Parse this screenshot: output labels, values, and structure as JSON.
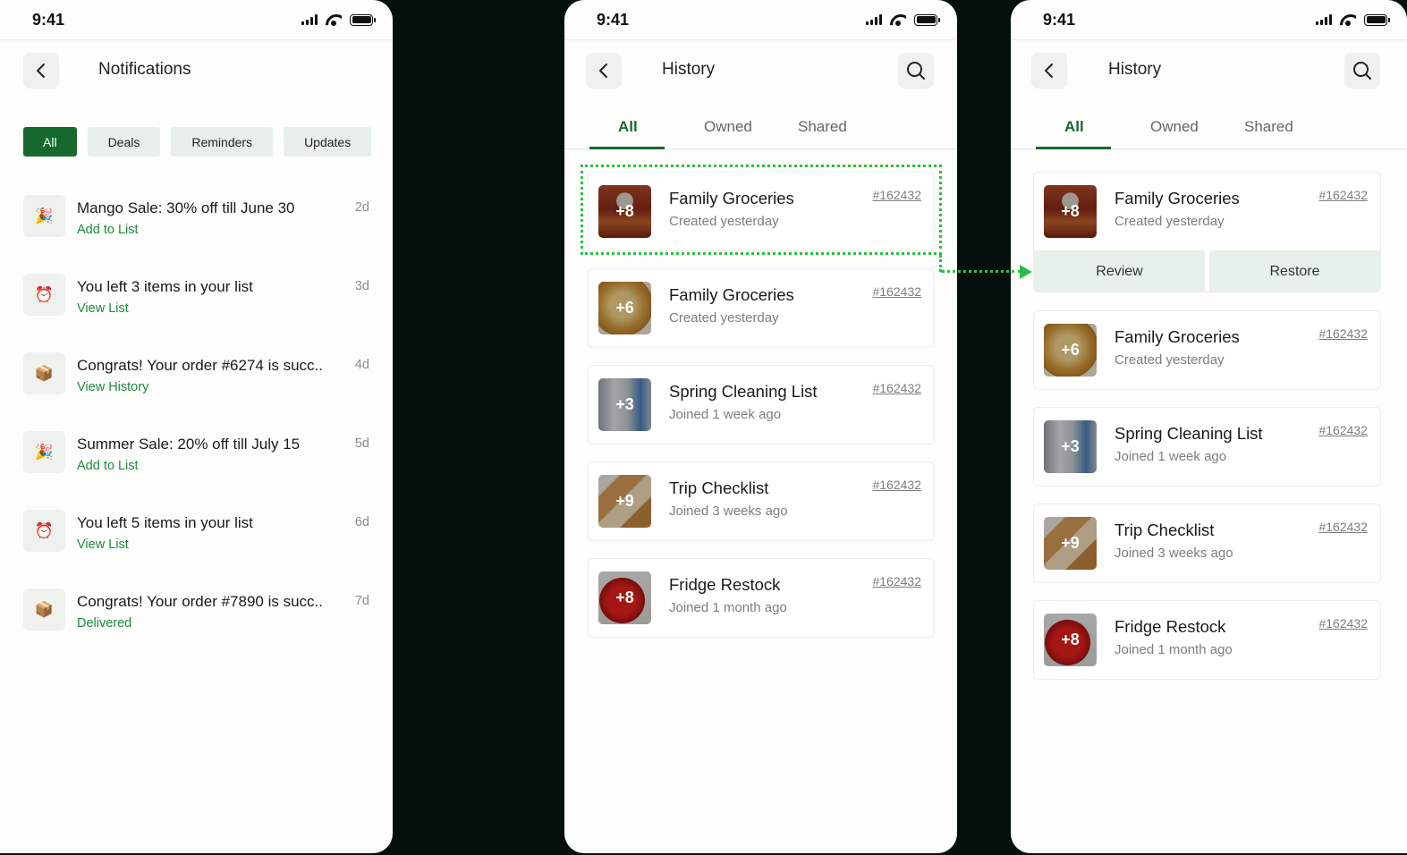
{
  "status_time": "9:41",
  "notifications_screen": {
    "title": "Notifications",
    "filters": [
      "All",
      "Deals",
      "Reminders",
      "Updates"
    ],
    "items": [
      {
        "icon": "party-popper-icon",
        "glyph": "🎉",
        "title": "Mango Sale: 30% off till June 30",
        "action": "Add to List",
        "age": "2d"
      },
      {
        "icon": "alarm-clock-icon",
        "glyph": "⏰",
        "title": "You left 3 items in your list",
        "action": "View List",
        "age": "3d"
      },
      {
        "icon": "package-icon",
        "glyph": "📦",
        "title": "Congrats! Your order #6274 is succ..",
        "action": "View History",
        "age": "4d"
      },
      {
        "icon": "party-popper-icon",
        "glyph": "🎉",
        "title": "Summer Sale: 20% off till July 15",
        "action": "Add to List",
        "age": "5d"
      },
      {
        "icon": "alarm-clock-icon",
        "glyph": "⏰",
        "title": "You left 5 items in your list",
        "action": "View List",
        "age": "6d"
      },
      {
        "icon": "package-icon",
        "glyph": "📦",
        "title": "Congrats! Your order #7890 is succ..",
        "action": "Delivered",
        "age": "7d"
      }
    ]
  },
  "history_screen": {
    "title": "History",
    "tabs": [
      "All",
      "Owned",
      "Shared"
    ],
    "lists": [
      {
        "title": "Family Groceries",
        "subtitle": "Created yesterday",
        "id": "#162432",
        "extra": "+8",
        "image": "jar"
      },
      {
        "title": "Family Groceries",
        "subtitle": "Created yesterday",
        "id": "#162432",
        "extra": "+6",
        "image": "bread"
      },
      {
        "title": "Spring Cleaning List",
        "subtitle": "Joined 1 week ago",
        "id": "#162432",
        "extra": "+3",
        "image": "can"
      },
      {
        "title": "Trip Checklist",
        "subtitle": "Joined 3 weeks ago",
        "id": "#162432",
        "extra": "+9",
        "image": "toast"
      },
      {
        "title": "Fridge Restock",
        "subtitle": "Joined 1 month ago",
        "id": "#162432",
        "extra": "+8",
        "image": "pepper"
      }
    ],
    "swipe_actions": {
      "review": "Review",
      "restore": "Restore"
    }
  },
  "colors": {
    "brand_green": "#176a2d",
    "link_green": "#1e8a3c",
    "highlight_green": "#2bbf4a"
  }
}
